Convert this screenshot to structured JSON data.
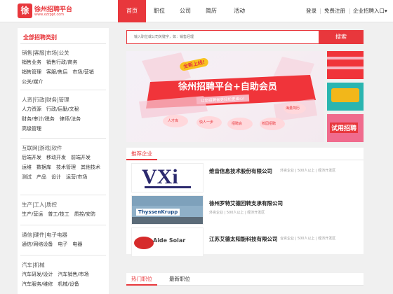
{
  "header": {
    "logo_mark": "徐",
    "logo_title": "徐州招聘平台",
    "logo_sub": "www.xzzppt.com",
    "nav": [
      "首页",
      "职位",
      "公司",
      "简历",
      "活动"
    ],
    "login": "登录",
    "separator": "|",
    "register": "免费注册",
    "enterprise": "企业招聘入口",
    "enterprise_arrow": "▾"
  },
  "sidebar": {
    "title": "全部招聘类别",
    "categories": [
      {
        "head": "销售|客服|市场|公关",
        "items": [
          "销售业务",
          "销售行政/商务",
          "销售管理",
          "客服/售后",
          "市场/营销",
          "公关/媒介"
        ]
      },
      {
        "head": "人资|行政|财务|管理",
        "items": [
          "人力资源",
          "行政/后勤/文秘",
          "财务/审计/税务",
          "律师/法务",
          "高级管理"
        ]
      },
      {
        "head": "互联网|游戏|软件",
        "items": [
          "后端开发",
          "移动开发",
          "前端开发",
          "运维",
          "数据库",
          "技术管理",
          "其他技术",
          "测试",
          "产品",
          "设计",
          "运营/市场"
        ]
      },
      {
        "head": "生产|工人|质控",
        "items": [
          "生产/营运",
          "普工/技工",
          "质控/安防"
        ]
      },
      {
        "head": "通信|硬件|电子电器",
        "items": [
          "通信/网络设备",
          "电子",
          "电器"
        ]
      },
      {
        "head": "汽车|机械",
        "items": [
          "汽车研发/设计",
          "汽车销售/市场",
          "汽车服务/维修",
          "机械/设备"
        ]
      }
    ]
  },
  "search": {
    "placeholder": "输入职位或公司关键字，如：销售经理",
    "button": "搜索"
  },
  "banner": {
    "badge": "全新上线!",
    "headline": "徐州招聘平台+自助会员",
    "ribbon": "让您招聘省更轻松更省心!",
    "tags": [
      "人才库",
      "快人一步",
      "招聘会",
      "校园招聘",
      "海量简历"
    ],
    "thumb_text": "试用招聘"
  },
  "colors": {
    "accent": "#e8373c",
    "banner_red": "#f0343a",
    "banner_pink": "#f6c7d2"
  },
  "recommend": {
    "tab": "推荐企业",
    "companies": [
      {
        "name": "维音信息技术股份有限公司",
        "meta": "外资企业 | 500人以上 | 经济开发区",
        "logo_text": "VXi"
      },
      {
        "name": "徐州罗特艾德回转支承有限公司",
        "meta": "外资企业 | 500人以上 | 经济开发区",
        "logo_text": "ThyssenKrupp"
      },
      {
        "name": "江苏艾德太阳能科技有限公司",
        "meta": "合资企业 | 500人以上 | 经济开发区",
        "logo_text": "Aide Solar"
      }
    ]
  },
  "jobs": {
    "tabs": [
      "热门职位",
      "最新职位"
    ]
  }
}
